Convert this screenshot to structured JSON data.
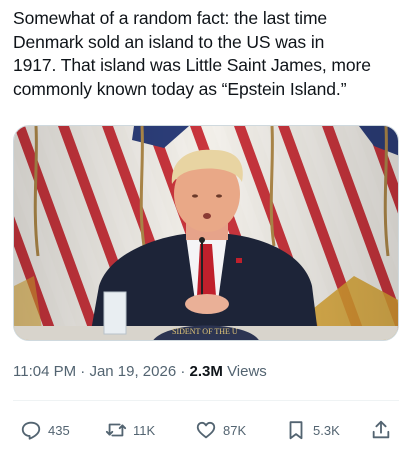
{
  "tweet": {
    "text": "Somewhat of a random fact: the last time\nDenmark sold an island to the US was in\n1917. That island was Little Saint James, more\ncommonly known today as “Epstein Island.”",
    "media": {
      "description_icon": "photo-image",
      "seal_text": "SIDENT OF THE U"
    },
    "time": "11:04 PM",
    "date": "Jan 19, 2026",
    "separator": "·",
    "views_count": "2.3M",
    "views_label": "Views"
  },
  "actions": {
    "replies": {
      "icon": "reply-icon",
      "count": "435"
    },
    "reposts": {
      "icon": "repost-icon",
      "count": "11K"
    },
    "likes": {
      "icon": "heart-icon",
      "count": "87K"
    },
    "bookmarks": {
      "icon": "bookmark-icon",
      "count": "5.3K"
    },
    "share": {
      "icon": "share-icon"
    }
  },
  "colors": {
    "text": "#0f1419",
    "secondary": "#536471",
    "border": "#cfd9de"
  }
}
